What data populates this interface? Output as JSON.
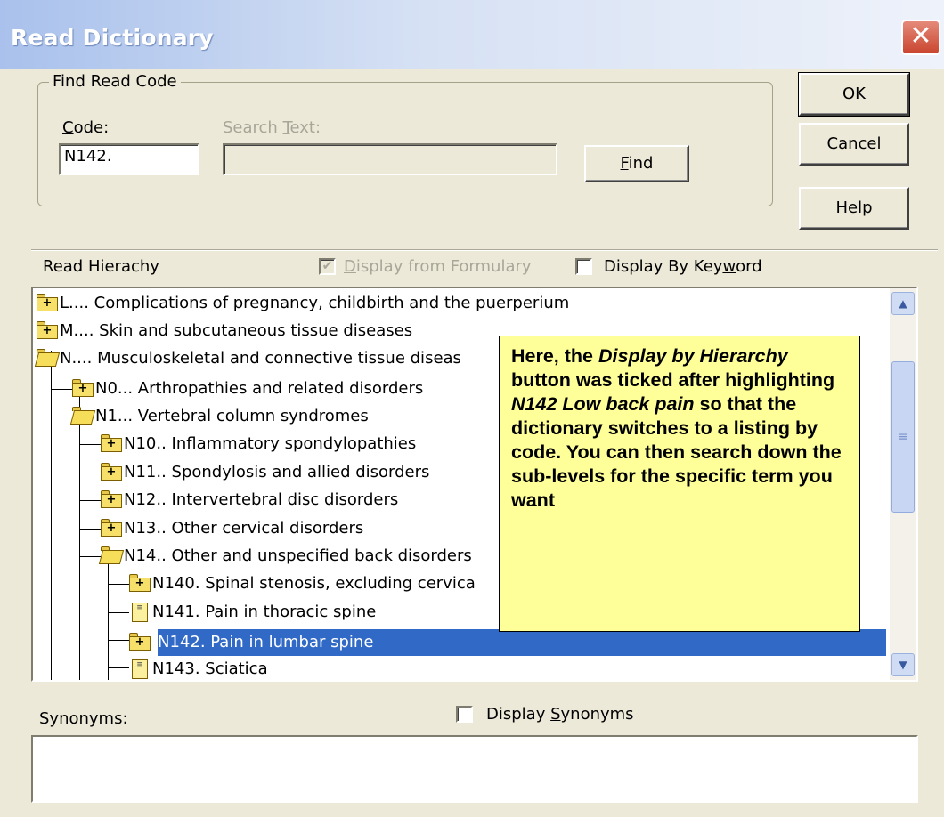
{
  "window": {
    "title": "Read Dictionary",
    "close_glyph": "✕"
  },
  "find_group": {
    "legend": "Find Read Code",
    "code_label_u": "C",
    "code_label_rest": "ode:",
    "code_value": "N142.",
    "search_label_pre": "Search ",
    "search_label_u": "T",
    "search_label_post": "ext:",
    "search_value": "",
    "find_u": "F",
    "find_rest": "ind"
  },
  "buttons": {
    "ok": "OK",
    "cancel": "Cancel",
    "help_u": "H",
    "help_rest": "elp"
  },
  "hierarchy": {
    "label": "Read Hierachy",
    "formulary_label_pre": "D",
    "formulary_label_rest": "isplay from Formulary",
    "formulary_checked": true,
    "keyword_label_pre": "Display By Key",
    "keyword_label_u": "w",
    "keyword_label_post": "ord",
    "keyword_checked": false
  },
  "tree_rows": [
    {
      "text": "L.... Complications of pregnancy, childbirth and the puerperium",
      "icon": "folder-plus"
    },
    {
      "text": "M.... Skin and subcutaneous tissue diseases",
      "icon": "folder-plus"
    },
    {
      "text": "N.... Musculoskeletal and connective tissue diseas",
      "icon": "folder-open"
    },
    {
      "text": "N0... Arthropathies and related disorders",
      "icon": "folder-plus"
    },
    {
      "text": "N1... Vertebral column syndromes",
      "icon": "folder-open"
    },
    {
      "text": "N10.. Inflammatory spondylopathies",
      "icon": "folder-plus"
    },
    {
      "text": "N11.. Spondylosis and allied disorders",
      "icon": "folder-plus"
    },
    {
      "text": "N12.. Intervertebral disc disorders",
      "icon": "folder-plus"
    },
    {
      "text": "N13.. Other cervical disorders",
      "icon": "folder-plus"
    },
    {
      "text": "N14.. Other and unspecified back disorders",
      "icon": "folder-open"
    },
    {
      "text": "N140. Spinal stenosis, excluding cervica",
      "icon": "folder-plus"
    },
    {
      "text": "N141. Pain in thoracic spine",
      "icon": "document"
    },
    {
      "text": "N142. Pain in lumbar spine",
      "icon": "folder-plus",
      "selected": true
    },
    {
      "text": "N143. Sciatica",
      "icon": "document"
    }
  ],
  "callout": {
    "p1": "Here, the ",
    "i1": "Display by Hierarchy",
    "p2": " button was ticked after highlighting ",
    "i2": "N142 Low back pain",
    "p3": " so that the dictionary switches to a listing by code.  You can then search down the sub-levels for the specific term you want"
  },
  "synonyms": {
    "label": "Synonyms:",
    "display_pre": "Display ",
    "display_u": "S",
    "display_post": "ynonyms",
    "checked": false
  }
}
